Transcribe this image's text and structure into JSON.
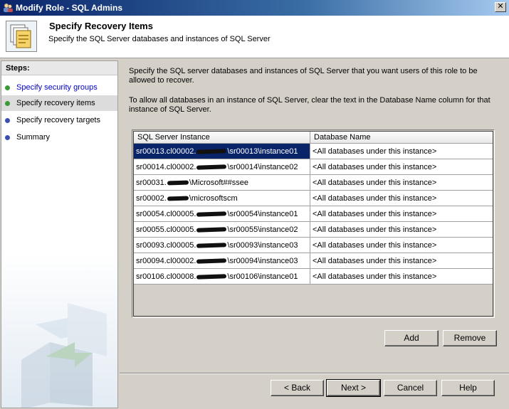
{
  "window": {
    "title": "Modify Role - SQL Admins",
    "close_glyph": "✕"
  },
  "header": {
    "title": "Specify Recovery Items",
    "subtitle": "Specify the SQL Server databases and instances of SQL Server"
  },
  "steps": {
    "title": "Steps:",
    "items": [
      {
        "label": "Specify security groups",
        "status": "complete",
        "dot_color": "#3a9a3a"
      },
      {
        "label": "Specify recovery items",
        "status": "current",
        "dot_color": "#3a9a3a"
      },
      {
        "label": "Specify recovery targets",
        "status": "pending",
        "dot_color": "#3a4fb0"
      },
      {
        "label": "Summary",
        "status": "pending",
        "dot_color": "#3a4fb0"
      }
    ]
  },
  "content": {
    "description": "Specify the SQL server databases and instances of SQL Server that you want users of this role to be allowed to recover.",
    "hint": "To allow all databases in an instance of SQL Server, clear the text in the Database Name column for that instance of SQL Server.",
    "grid": {
      "columns": [
        "SQL Server Instance",
        "Database Name"
      ],
      "rows": [
        {
          "pre": "sr00013.cl00002.",
          "post": "\\sr00013\\instance01",
          "db": "<All databases under this instance>",
          "selected": true
        },
        {
          "pre": "sr00014.cl00002.",
          "post": "\\sr00014\\instance02",
          "db": "<All databases under this instance>",
          "selected": false
        },
        {
          "pre": "sr00031.",
          "post": "\\Microsoft##ssee",
          "db": "<All databases under this instance>",
          "selected": false
        },
        {
          "pre": "sr00002.",
          "post": "\\microsoftscm",
          "db": "<All databases under this instance>",
          "selected": false
        },
        {
          "pre": "sr00054.cl00005.",
          "post": "\\sr00054\\instance01",
          "db": "<All databases under this instance>",
          "selected": false
        },
        {
          "pre": "sr00055.cl00005.",
          "post": "\\sr00055\\instance02",
          "db": "<All databases under this instance>",
          "selected": false
        },
        {
          "pre": "sr00093.cl00005.",
          "post": "\\sr00093\\instance03",
          "db": "<All databases under this instance>",
          "selected": false
        },
        {
          "pre": "sr00094.cl00002.",
          "post": "\\sr00094\\instance03",
          "db": "<All databases under this instance>",
          "selected": false
        },
        {
          "pre": "sr00106.cl00008.",
          "post": "\\sr00106\\instance01",
          "db": "<All databases under this instance>",
          "selected": false
        }
      ]
    },
    "add_label": "Add",
    "remove_label": "Remove"
  },
  "footer": {
    "back_label": "< Back",
    "next_label": "Next >",
    "cancel_label": "Cancel",
    "help_label": "Help"
  }
}
